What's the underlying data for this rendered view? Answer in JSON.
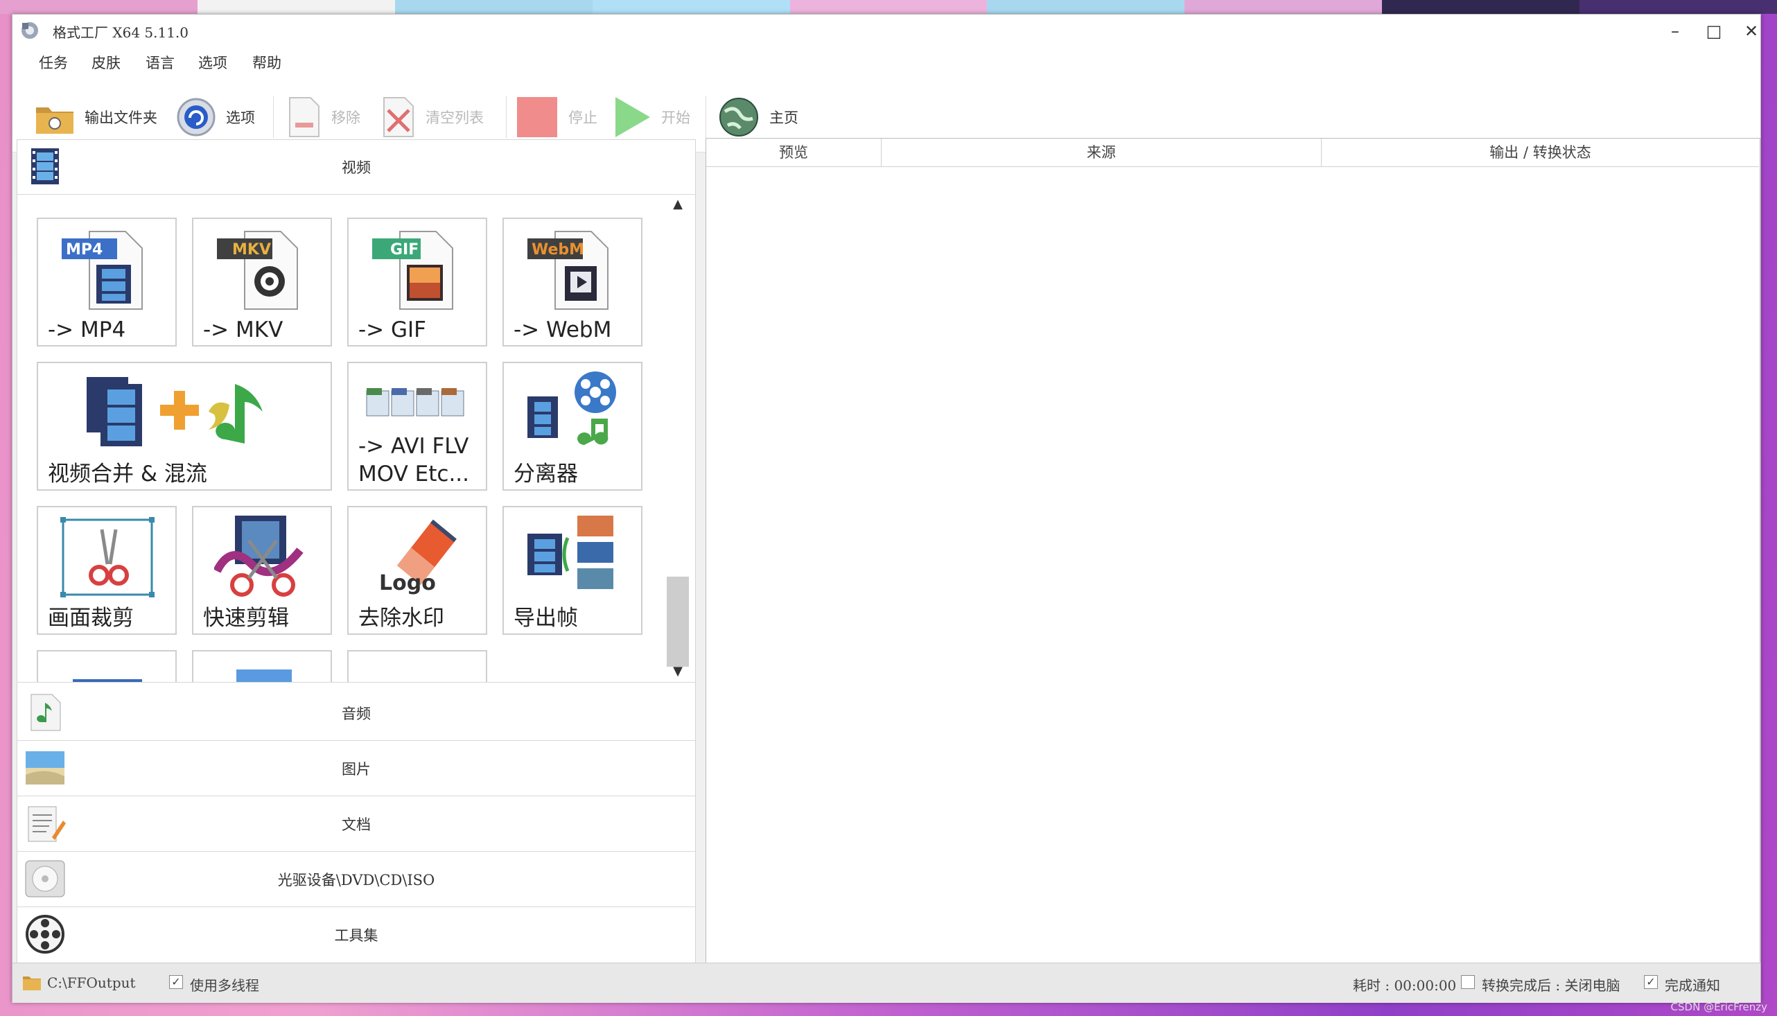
{
  "window": {
    "title": "格式工厂 X64 5.11.0",
    "controls": {
      "minimize": "–",
      "maximize": "□",
      "close": "✕"
    }
  },
  "menu": [
    "任务",
    "皮肤",
    "语言",
    "选项",
    "帮助"
  ],
  "toolbar": {
    "output_folder": "输出文件夹",
    "options": "选项",
    "remove": "移除",
    "clear_list": "清空列表",
    "stop": "停止",
    "start": "开始",
    "home": "主页"
  },
  "categories": {
    "video": "视频",
    "audio": "音频",
    "picture": "图片",
    "document": "文档",
    "rom": "光驱设备\\DVD\\CD\\ISO",
    "tools": "工具集"
  },
  "video_tiles": {
    "mp4": {
      "badge": "MP4",
      "label": "-> MP4"
    },
    "mkv": {
      "badge": "MKV",
      "label": "-> MKV"
    },
    "gif": {
      "badge": "GIF",
      "label": "-> GIF"
    },
    "webm": {
      "badge": "WebM",
      "label": "-> WebM"
    },
    "join_mux": {
      "label": "视频合并 & 混流"
    },
    "avi_flv": {
      "label": "-> AVI FLV\nMOV Etc..."
    },
    "splitter": {
      "label": "分离器"
    },
    "crop": {
      "label": "画面裁剪"
    },
    "quick_clip": {
      "label": "快速剪辑"
    },
    "remove_watermark": {
      "label": "去除水印",
      "logo_text": "Logo"
    },
    "export_frames": {
      "label": "导出帧"
    }
  },
  "task_list": {
    "columns": [
      "预览",
      "来源",
      "输出 / 转换状态"
    ]
  },
  "status": {
    "output_path": "C:\\FFOutput",
    "multithread_label": "使用多线程",
    "multithread_checked": true,
    "elapsed": "耗时 : 00:00:00",
    "after_convert_label": "转换完成后 : 关闭电脑",
    "after_convert_checked": false,
    "notify_label": "完成通知",
    "notify_checked": true,
    "watermark": "CSDN @EricFrenzy"
  }
}
